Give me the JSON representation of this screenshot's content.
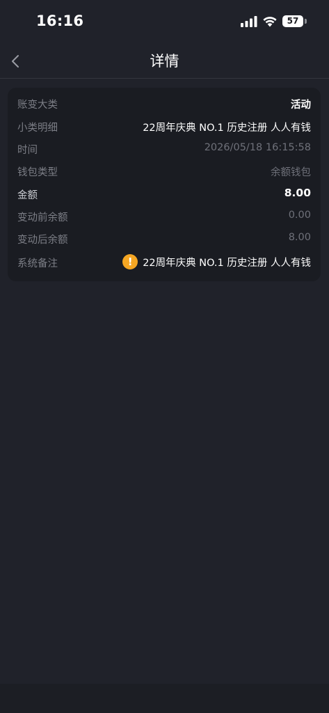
{
  "status_bar": {
    "time": "16:16",
    "battery_level": "57"
  },
  "nav": {
    "title": "详情"
  },
  "details": {
    "category": {
      "label": "账变大类",
      "value": "活动"
    },
    "subcategory": {
      "label": "小类明细",
      "value": "22周年庆典 NO.1 历史注册 人人有钱"
    },
    "time": {
      "label": "时间",
      "value": "2026/05/18 16:15:58"
    },
    "wallet_type": {
      "label": "钱包类型",
      "value": "余额钱包"
    },
    "amount": {
      "label": "金额",
      "value": "8.00"
    },
    "balance_before": {
      "label": "变动前余额",
      "value": "0.00"
    },
    "balance_after": {
      "label": "变动后余额",
      "value": "8.00"
    },
    "system_note": {
      "label": "系统备注",
      "value": "22周年庆典 NO.1 历史注册 人人有钱",
      "icon": "warning-icon"
    }
  },
  "colors": {
    "background": "#20222a",
    "card": "#1a1c22",
    "label": "#7c7e86",
    "warning": "#f5a623"
  }
}
